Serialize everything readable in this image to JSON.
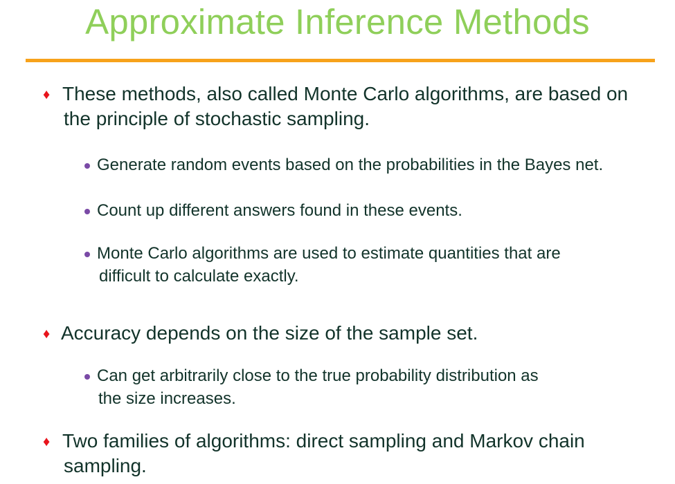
{
  "slide": {
    "title": "Approximate Inference Methods",
    "accent_title_color": "#8fcf5a",
    "accent_rule_color": "#f7a21b",
    "bullet_diamond_color": "#e8141c",
    "bullet_dot_color": "#7a4aa6",
    "bullets": [
      {
        "lines": [
          "These methods, also called Monte Carlo algorithms, are based on",
          "the principle of stochastic sampling."
        ],
        "sub": [
          {
            "lines": [
              "Generate random events based on the probabilities in the Bayes net."
            ]
          },
          {
            "lines": [
              "Count up different answers found in these events."
            ]
          },
          {
            "lines": [
              "Monte Carlo algorithms are used to estimate quantities that are",
              "difficult to calculate exactly."
            ]
          }
        ]
      },
      {
        "lines": [
          "Accuracy depends on the size of the sample set."
        ],
        "sub": [
          {
            "lines": [
              "Can get arbitrarily close to the true probability distribution as",
              "the size increases."
            ]
          }
        ]
      },
      {
        "lines": [
          "Two families of algorithms: direct sampling and Markov chain",
          "sampling."
        ],
        "sub": []
      }
    ]
  }
}
